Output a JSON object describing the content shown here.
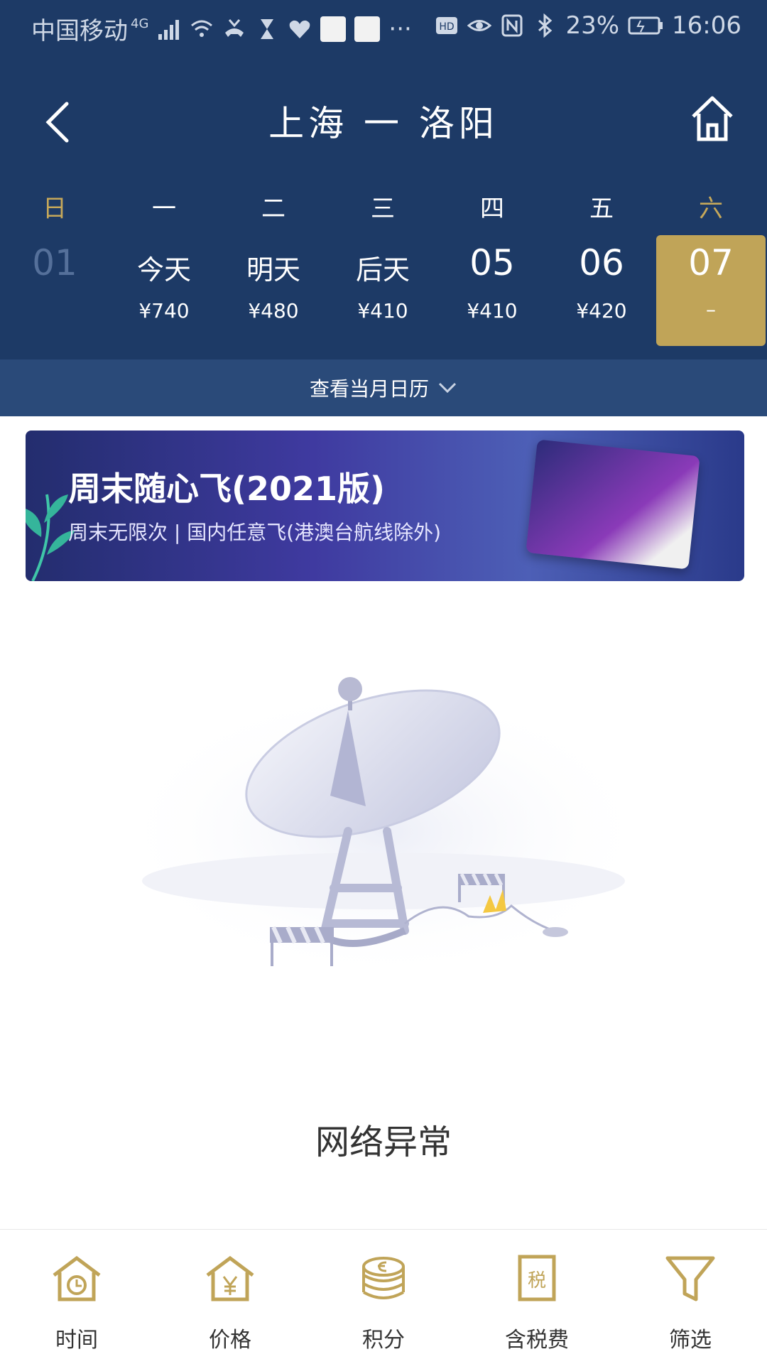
{
  "status_bar": {
    "carrier": "中国移动",
    "network": "4G",
    "battery": "23%",
    "time": "16:06"
  },
  "header": {
    "route": "上海 一 洛阳",
    "back_icon": "chevron-left-icon",
    "home_icon": "home-icon"
  },
  "week_days": [
    "日",
    "一",
    "二",
    "三",
    "四",
    "五",
    "六"
  ],
  "dates": [
    {
      "label": "01",
      "price": ""
    },
    {
      "label": "今天",
      "price": "¥740"
    },
    {
      "label": "明天",
      "price": "¥480"
    },
    {
      "label": "后天",
      "price": "¥410"
    },
    {
      "label": "05",
      "price": "¥410"
    },
    {
      "label": "06",
      "price": "¥420"
    },
    {
      "label": "07",
      "price": "–"
    }
  ],
  "calendar_link": "查看当月日历",
  "banner": {
    "title": "周末随心飞(2021版)",
    "subtitle": "周末无限次 | 国内任意飞(港澳台航线除外)"
  },
  "error": {
    "message": "网络异常"
  },
  "bottom_nav": [
    {
      "label": "时间",
      "icon": "clock-house-icon"
    },
    {
      "label": "价格",
      "icon": "yen-house-icon"
    },
    {
      "label": "积分",
      "icon": "coins-icon"
    },
    {
      "label": "含税费",
      "icon": "tax-receipt-icon"
    },
    {
      "label": "筛选",
      "icon": "filter-icon"
    }
  ],
  "colors": {
    "header_bg": "#1d3a66",
    "accent_gold": "#c0a458",
    "selected_date_bg": "#c0a458"
  }
}
